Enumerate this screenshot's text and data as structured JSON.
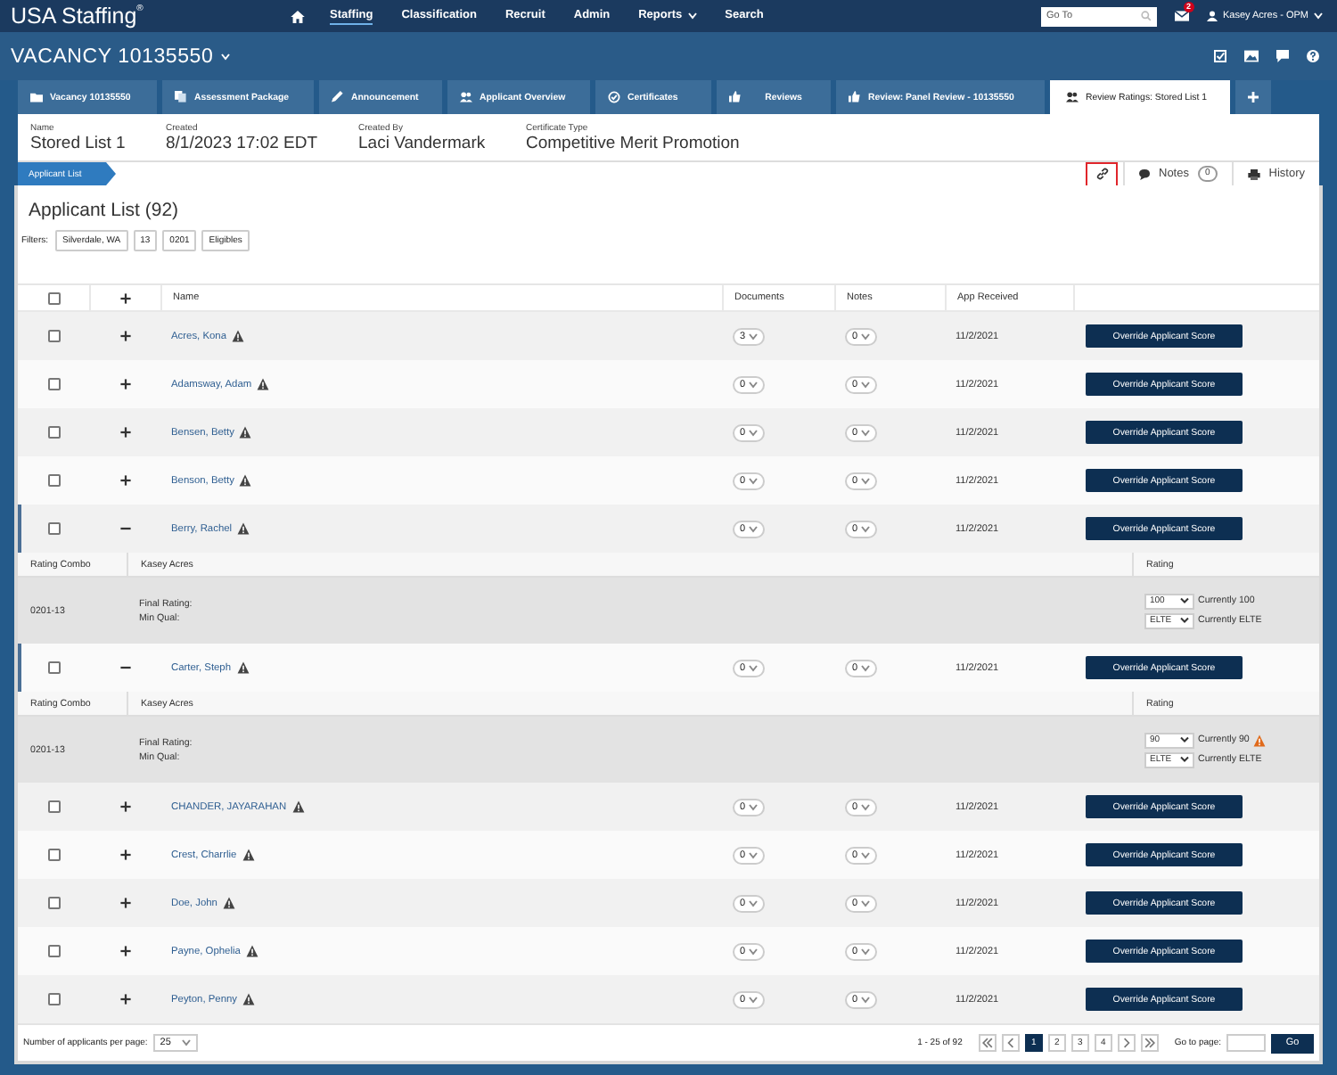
{
  "header": {
    "logo": "USA Staffing$^{®}$",
    "nav": [
      {
        "label": "Staffing",
        "selected": true,
        "dropdown": false
      },
      {
        "label": "Classification",
        "selected": false,
        "dropdown": false
      },
      {
        "label": "Recruit",
        "selected": false,
        "dropdown": false
      },
      {
        "label": "Admin",
        "selected": false,
        "dropdown": false
      },
      {
        "label": "Reports",
        "selected": false,
        "dropdown": true
      },
      {
        "label": "Search",
        "selected": false,
        "dropdown": false
      }
    ],
    "search": {
      "placeholder": "Go To"
    },
    "notifications": "2",
    "user": "Kasey Acres - OPM"
  },
  "vacancy": {
    "title": "VACANCY 10135550"
  },
  "tabs": [
    {
      "label": "Vacancy 10135550",
      "selected": false
    },
    {
      "label": "Assessment Package",
      "selected": false
    },
    {
      "label": "Announcement",
      "selected": false
    },
    {
      "label": "Applicant Overview",
      "selected": false
    },
    {
      "label": "Certificates",
      "selected": false
    },
    {
      "label": "Reviews",
      "selected": false
    },
    {
      "label": "Review: Panel Review - 10135550",
      "selected": false
    },
    {
      "label": "Review Ratings: Stored List 1",
      "selected": true
    }
  ],
  "info": [
    {
      "label": "Name",
      "value": "Stored List 1"
    },
    {
      "label": "Created",
      "value": "8/1/2023 17:02 EDT"
    },
    {
      "label": "Created By",
      "value": "Laci Vandermark"
    },
    {
      "label": "Certificate Type",
      "value": "Competitive Merit Promotion"
    }
  ],
  "breadcrumb": "Applicant List",
  "actions": {
    "notes": "Notes",
    "notes_count": "0",
    "history": "History"
  },
  "list": {
    "title": "Applicant List (92)",
    "filters_label": "Filters:",
    "filters": [
      "Silverdale, WA",
      "13",
      "0201",
      "Eligibles"
    ]
  },
  "table": {
    "all_checked": false,
    "columns": [
      "Name",
      "Documents",
      "Notes",
      "App Received"
    ],
    "rows": [
      {
        "name": "Acres, Kona",
        "warning": true,
        "documents": "3",
        "notes": "0",
        "received": "11/2/2021",
        "action": "Override Applicant Score",
        "checked": false,
        "expanded": false
      },
      {
        "name": "Adamsway, Adam",
        "warning": true,
        "documents": "0",
        "notes": "0",
        "received": "11/2/2021",
        "action": "Override Applicant Score",
        "checked": false,
        "expanded": false
      },
      {
        "name": "Bensen, Betty",
        "warning": true,
        "documents": "0",
        "notes": "0",
        "received": "11/2/2021",
        "action": "Override Applicant Score",
        "checked": false,
        "expanded": false
      },
      {
        "name": "Benson, Betty",
        "warning": true,
        "documents": "0",
        "notes": "0",
        "received": "11/2/2021",
        "action": "Override Applicant Score",
        "checked": false,
        "expanded": false
      },
      {
        "name": "Berry, Rachel",
        "warning": true,
        "documents": "0",
        "notes": "0",
        "received": "11/2/2021",
        "action": "Override Applicant Score",
        "checked": false,
        "expanded": true,
        "detail": {
          "combo_header": "Rating Combo",
          "rater": "Kasey Acres",
          "rating_header": "Rating",
          "combo": "0201-13",
          "labels": [
            "Final Rating:",
            "Min Qual:"
          ],
          "ratings": [
            {
              "value": "100",
              "current": "Currently 100",
              "warning": false
            },
            {
              "value": "ELTE",
              "current": "Currently ELTE",
              "warning": false
            }
          ]
        }
      },
      {
        "name": "Carter, Steph",
        "warning": true,
        "documents": "0",
        "notes": "0",
        "received": "11/2/2021",
        "action": "Override Applicant Score",
        "checked": false,
        "expanded": true,
        "detail": {
          "combo_header": "Rating Combo",
          "rater": "Kasey Acres",
          "rating_header": "Rating",
          "combo": "0201-13",
          "labels": [
            "Final Rating:",
            "Min Qual:"
          ],
          "ratings": [
            {
              "value": "90",
              "current": "Currently 90",
              "warning": true
            },
            {
              "value": "ELTE",
              "current": "Currently ELTE",
              "warning": false
            }
          ]
        }
      },
      {
        "name": "CHANDER, JAYARAHAN",
        "warning": true,
        "documents": "0",
        "notes": "0",
        "received": "11/2/2021",
        "action": "Override Applicant Score",
        "checked": false,
        "expanded": false
      },
      {
        "name": "Crest, Charrlie",
        "warning": true,
        "documents": "0",
        "notes": "0",
        "received": "11/2/2021",
        "action": "Override Applicant Score",
        "checked": false,
        "expanded": false
      },
      {
        "name": "Doe, John",
        "warning": true,
        "documents": "0",
        "notes": "0",
        "received": "11/2/2021",
        "action": "Override Applicant Score",
        "checked": false,
        "expanded": false
      },
      {
        "name": "Payne, Ophelia",
        "warning": true,
        "documents": "0",
        "notes": "0",
        "received": "11/2/2021",
        "action": "Override Applicant Score",
        "checked": false,
        "expanded": false
      },
      {
        "name": "Peyton, Penny",
        "warning": true,
        "documents": "0",
        "notes": "0",
        "received": "11/2/2021",
        "action": "Override Applicant Score",
        "checked": false,
        "expanded": false
      }
    ]
  },
  "footer": {
    "per_page_label": "Number of applicants per page:",
    "per_page": "25",
    "range": "1 - 25 of 92",
    "pages": [
      {
        "label": "1",
        "selected": true
      },
      {
        "label": "2",
        "selected": false
      },
      {
        "label": "3",
        "selected": false
      },
      {
        "label": "4",
        "selected": false
      }
    ],
    "goto_label": "Go to page:",
    "go": "Go"
  }
}
